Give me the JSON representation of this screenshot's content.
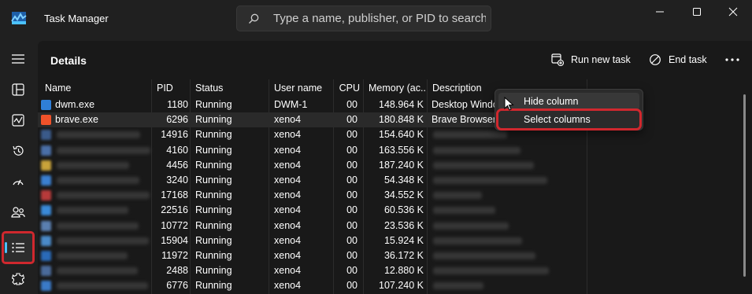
{
  "window": {
    "title": "Task Manager",
    "search_placeholder": "Type a name, publisher, or PID to search"
  },
  "nav": {
    "items": [
      {
        "icon": "hamburger-icon"
      },
      {
        "icon": "processes-icon"
      },
      {
        "icon": "performance-icon"
      },
      {
        "icon": "app-history-icon"
      },
      {
        "icon": "startup-apps-icon"
      },
      {
        "icon": "users-icon"
      },
      {
        "icon": "details-icon",
        "active": true
      },
      {
        "icon": "services-icon"
      }
    ]
  },
  "page": {
    "title": "Details",
    "run_new_task": "Run new task",
    "end_task": "End task",
    "more": "..."
  },
  "table": {
    "columns": [
      "Name",
      "PID",
      "Status",
      "User name",
      "CPU",
      "Memory (ac...",
      "Description"
    ],
    "rows": [
      {
        "name": "dwm.exe",
        "pid": "1180",
        "status": "Running",
        "user": "DWM-1",
        "cpu": "00",
        "memory": "148.964 K",
        "description": "Desktop Windo",
        "icon_color": "#2f7fd8"
      },
      {
        "name": "brave.exe",
        "pid": "6296",
        "status": "Running",
        "user": "xeno4",
        "cpu": "00",
        "memory": "180.848 K",
        "description": "Brave Browser",
        "icon_color": "#f0522a"
      },
      {
        "name": "",
        "pid": "14916",
        "status": "Running",
        "user": "xeno4",
        "cpu": "00",
        "memory": "154.640 K",
        "description": "",
        "icon_color": "#3a5a8a"
      },
      {
        "name": "",
        "pid": "4160",
        "status": "Running",
        "user": "xeno4",
        "cpu": "00",
        "memory": "163.556 K",
        "description": "",
        "icon_color": "#4a6fa8"
      },
      {
        "name": "",
        "pid": "4456",
        "status": "Running",
        "user": "xeno4",
        "cpu": "00",
        "memory": "187.240 K",
        "description": "",
        "icon_color": "#c9a33a"
      },
      {
        "name": "",
        "pid": "3240",
        "status": "Running",
        "user": "xeno4",
        "cpu": "00",
        "memory": "54.348 K",
        "description": "",
        "icon_color": "#3b7fd0"
      },
      {
        "name": "",
        "pid": "17168",
        "status": "Running",
        "user": "xeno4",
        "cpu": "00",
        "memory": "34.552 K",
        "description": "",
        "icon_color": "#b83a3a"
      },
      {
        "name": "",
        "pid": "22516",
        "status": "Running",
        "user": "xeno4",
        "cpu": "00",
        "memory": "60.536 K",
        "description": "",
        "icon_color": "#3a8ad8"
      },
      {
        "name": "",
        "pid": "10772",
        "status": "Running",
        "user": "xeno4",
        "cpu": "00",
        "memory": "23.536 K",
        "description": "",
        "icon_color": "#5a7fb0"
      },
      {
        "name": "",
        "pid": "15904",
        "status": "Running",
        "user": "xeno4",
        "cpu": "00",
        "memory": "15.924 K",
        "description": "",
        "icon_color": "#4a8ac8"
      },
      {
        "name": "",
        "pid": "11972",
        "status": "Running",
        "user": "xeno4",
        "cpu": "00",
        "memory": "36.172 K",
        "description": "",
        "icon_color": "#2a6ab8"
      },
      {
        "name": "",
        "pid": "2488",
        "status": "Running",
        "user": "xeno4",
        "cpu": "00",
        "memory": "12.880 K",
        "description": "",
        "icon_color": "#4a6a9a"
      },
      {
        "name": "",
        "pid": "6776",
        "status": "Running",
        "user": "xeno4",
        "cpu": "00",
        "memory": "107.240 K",
        "description": "",
        "icon_color": "#3a7ac8"
      }
    ]
  },
  "context_menu": {
    "items": [
      "Hide column",
      "Select columns"
    ]
  }
}
